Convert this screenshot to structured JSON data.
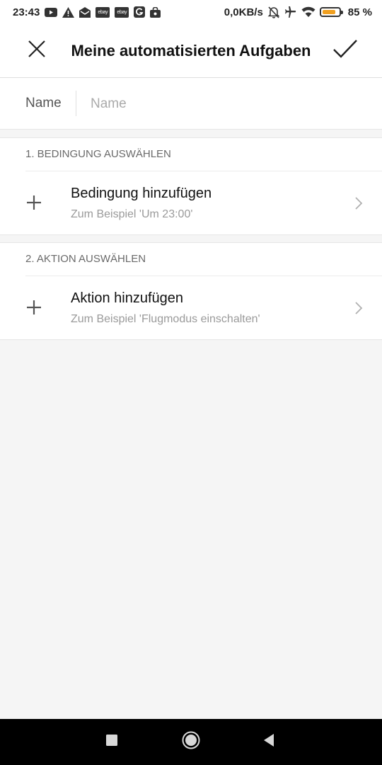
{
  "status_bar": {
    "time": "23:43",
    "notification_icons": [
      "youtube-icon",
      "warning-icon",
      "mail-icon",
      "ebay-icon",
      "ebay-icon",
      "app-g-icon",
      "bag-icon"
    ],
    "ebay_label_1": "ebay",
    "ebay_label_2": "ebay",
    "net_speed": "0,0KB/s",
    "right_icons": [
      "bell-off-icon",
      "airplane-icon",
      "wifi-icon",
      "battery-icon"
    ],
    "battery_level": 0.85,
    "battery_percent": "85 %",
    "battery_color": "#f0a020"
  },
  "header": {
    "title": "Meine automatisierten Aufgaben",
    "close_icon": "close-icon",
    "confirm_icon": "check-icon"
  },
  "name_field": {
    "label": "Name",
    "placeholder": "Name",
    "value": ""
  },
  "condition_section": {
    "heading": "1. BEDINGUNG AUSWÄHLEN",
    "item_title": "Bedingung hinzufügen",
    "item_subtitle": "Zum Beispiel 'Um 23:00'"
  },
  "action_section": {
    "heading": "2. AKTION AUSWÄHLEN",
    "item_title": "Aktion hinzufügen",
    "item_subtitle": "Zum Beispiel 'Flugmodus einschalten'"
  },
  "nav_bar": {
    "buttons": [
      "recents-icon",
      "home-icon",
      "back-icon"
    ]
  }
}
